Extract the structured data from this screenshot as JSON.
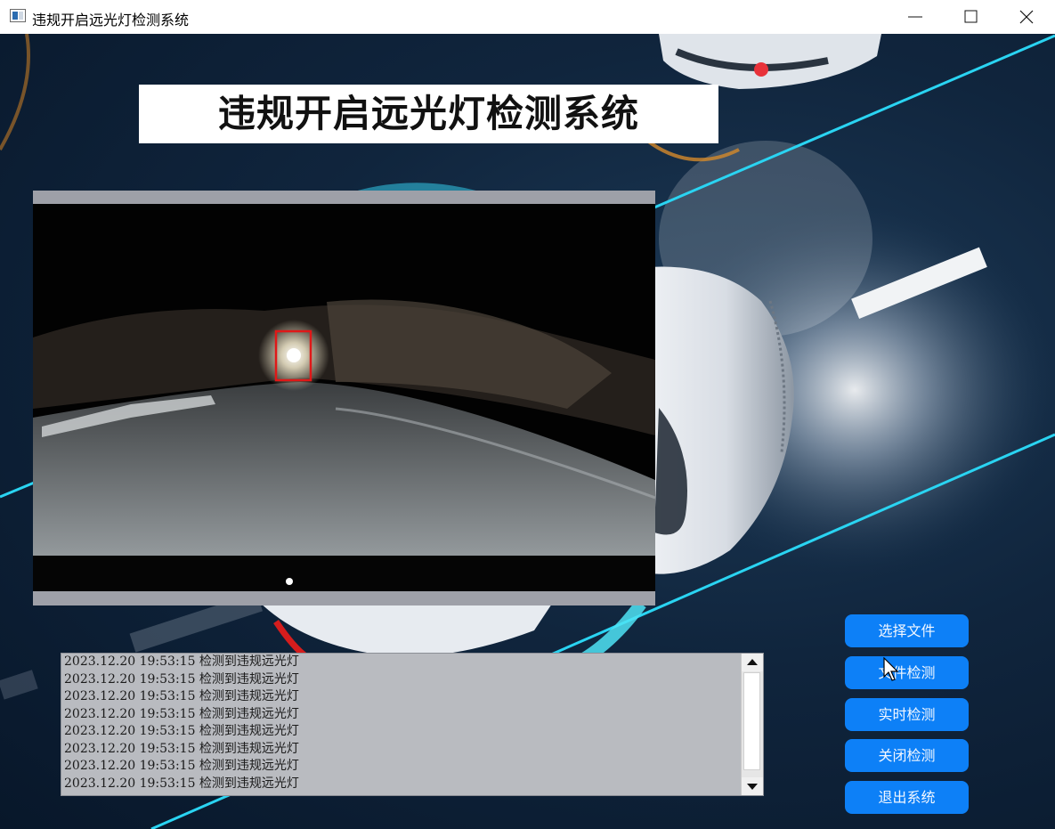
{
  "window": {
    "title": "违规开启远光灯检测系统",
    "controls": [
      "minimize",
      "maximize",
      "close"
    ]
  },
  "header": {
    "title": "违规开启远光灯检测系统"
  },
  "video": {
    "detection_box_color": "#e01818"
  },
  "log": {
    "lines": [
      "2023.12.20 19:53:15 检测到违规远光灯",
      "2023.12.20 19:53:15 检测到违规远光灯",
      "2023.12.20 19:53:15 检测到违规远光灯",
      "2023.12.20 19:53:15 检测到违规远光灯",
      "2023.12.20 19:53:15 检测到违规远光灯",
      "2023.12.20 19:53:15 检测到违规远光灯",
      "2023.12.20 19:53:15 检测到违规远光灯",
      "2023.12.20 19:53:15 检测到违规远光灯"
    ]
  },
  "buttons": {
    "select_file": "选择文件",
    "file_detect": "文件检测",
    "realtime_detect": "实时检测",
    "close_detect": "关闭检测",
    "exit_system": "退出系统"
  },
  "colors": {
    "button_bg": "#0d80f7",
    "accent_cyan": "#2ad4f2",
    "background_navy": "#0c1f33"
  }
}
